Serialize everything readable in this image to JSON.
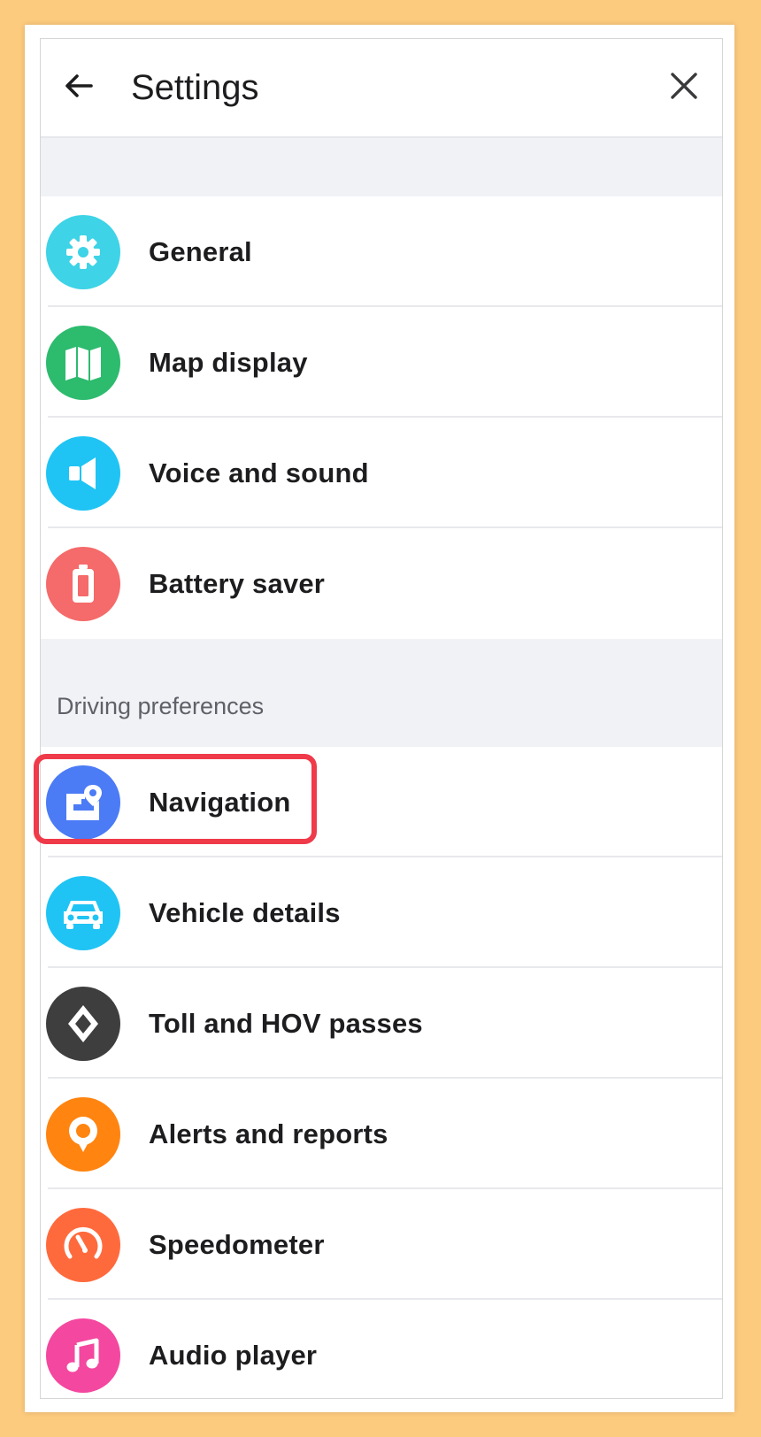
{
  "header": {
    "title": "Settings",
    "back_icon": "arrow-left-icon",
    "close_icon": "close-icon"
  },
  "groups": [
    {
      "section_label": "",
      "items": [
        {
          "label": "General",
          "icon": "gear-icon",
          "color": "#3ED3E6"
        },
        {
          "label": "Map display",
          "icon": "map-icon",
          "color": "#2DBB6E"
        },
        {
          "label": "Voice and sound",
          "icon": "speaker-icon",
          "color": "#1FC4F4"
        },
        {
          "label": "Battery saver",
          "icon": "battery-icon",
          "color": "#F56A6A"
        }
      ]
    },
    {
      "section_label": "Driving preferences",
      "items": [
        {
          "label": "Navigation",
          "icon": "navigation-pin-icon",
          "color": "#4B7BF5"
        },
        {
          "label": "Vehicle details",
          "icon": "car-icon",
          "color": "#1FC4F4"
        },
        {
          "label": "Toll and HOV passes",
          "icon": "diamond-icon",
          "color": "#3E3E3E"
        },
        {
          "label": "Alerts and reports",
          "icon": "alert-pin-icon",
          "color": "#FF8410"
        },
        {
          "label": "Speedometer",
          "icon": "speedometer-icon",
          "color": "#FF6A3D"
        },
        {
          "label": "Audio player",
          "icon": "music-note-icon",
          "color": "#F4479F"
        }
      ]
    }
  ],
  "highlighted_item": "Navigation",
  "colors": {
    "background": "#FDCB7E",
    "section_bg": "#f1f2f6",
    "highlight_border": "#ef3a4a"
  }
}
